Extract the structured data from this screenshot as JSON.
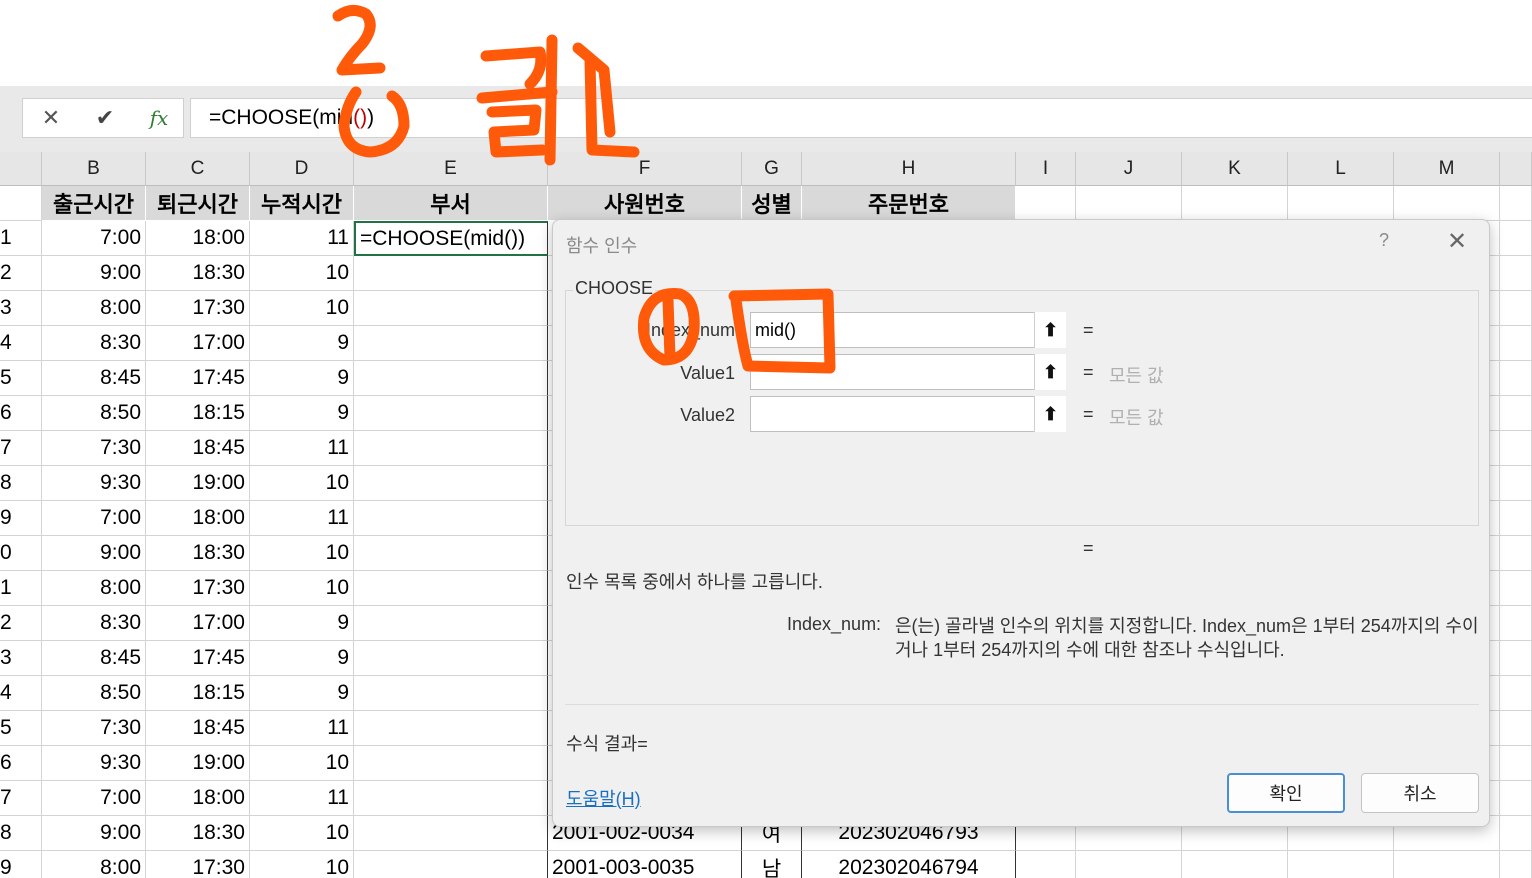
{
  "formula_bar": {
    "cancel_icon": "close-icon",
    "enter_icon": "check-icon",
    "fx_label": "fx",
    "formula_main": "=CHOOSE(mid",
    "formula_paren": "()",
    "formula_tail": ")"
  },
  "columns": [
    "B",
    "C",
    "D",
    "E",
    "F",
    "G",
    "H",
    "I",
    "J",
    "K",
    "L",
    "M"
  ],
  "sheet": {
    "headers": [
      "출근시간",
      "퇴근시간",
      "누적시간",
      "부서",
      "사원번호",
      "성별",
      "주문번호"
    ],
    "row_numbers": [
      "1",
      "2",
      "3",
      "4",
      "5",
      "6",
      "7",
      "8",
      "9",
      "0",
      "1",
      "2",
      "3",
      "4",
      "5",
      "6",
      "7",
      "8",
      "9"
    ],
    "rows": [
      [
        "7:00",
        "18:00",
        "11",
        "=CHOOSE(mid())",
        "",
        "",
        ""
      ],
      [
        "9:00",
        "18:30",
        "10",
        "",
        "",
        "",
        ""
      ],
      [
        "8:00",
        "17:30",
        "10",
        "",
        "",
        "",
        ""
      ],
      [
        "8:30",
        "17:00",
        "9",
        "",
        "",
        "",
        ""
      ],
      [
        "8:45",
        "17:45",
        "9",
        "",
        "",
        "",
        ""
      ],
      [
        "8:50",
        "18:15",
        "9",
        "",
        "",
        "",
        ""
      ],
      [
        "7:30",
        "18:45",
        "11",
        "",
        "",
        "",
        ""
      ],
      [
        "9:30",
        "19:00",
        "10",
        "",
        "",
        "",
        ""
      ],
      [
        "7:00",
        "18:00",
        "11",
        "",
        "",
        "",
        ""
      ],
      [
        "9:00",
        "18:30",
        "10",
        "",
        "",
        "",
        ""
      ],
      [
        "8:00",
        "17:30",
        "10",
        "",
        "",
        "",
        ""
      ],
      [
        "8:30",
        "17:00",
        "9",
        "",
        "",
        "",
        ""
      ],
      [
        "8:45",
        "17:45",
        "9",
        "",
        "",
        "",
        ""
      ],
      [
        "8:50",
        "18:15",
        "9",
        "",
        "",
        "",
        ""
      ],
      [
        "7:30",
        "18:45",
        "11",
        "",
        "",
        "",
        ""
      ],
      [
        "9:30",
        "19:00",
        "10",
        "",
        "",
        "",
        ""
      ],
      [
        "7:00",
        "18:00",
        "11",
        "",
        "",
        "",
        ""
      ],
      [
        "9:00",
        "18:30",
        "10",
        "",
        "2001-002-0034",
        "여",
        "202302046793"
      ],
      [
        "8:00",
        "17:30",
        "10",
        "",
        "2001-003-0035",
        "남",
        "202302046794"
      ]
    ]
  },
  "dialog": {
    "title": "함수 인수",
    "help": "?",
    "close_icon": "close-icon",
    "function_name": "CHOOSE",
    "args": [
      {
        "label": "Index_num",
        "value": "mid()",
        "result_eq": "=",
        "result": ""
      },
      {
        "label": "Value1",
        "value": "",
        "result_eq": "=",
        "result": "모든 값"
      },
      {
        "label": "Value2",
        "value": "",
        "result_eq": "=",
        "result": "모든 값"
      }
    ],
    "result_eq": "=",
    "description": "인수 목록 중에서 하나를 고릅니다.",
    "arg_name": "Index_num:",
    "arg_description": "은(는) 골라낼 인수의 위치를 지정합니다. Index_num은 1부터 254까지의 수이거나 1부터 254까지의 수에 대한 참조나 수식입니다.",
    "formula_result": "수식 결과=",
    "help_link": "도움말(H)",
    "ok": "확인",
    "cancel": "취소"
  },
  "annotation": {
    "step_number": "2",
    "text": "클릭",
    "color": "#ff5a0a"
  }
}
